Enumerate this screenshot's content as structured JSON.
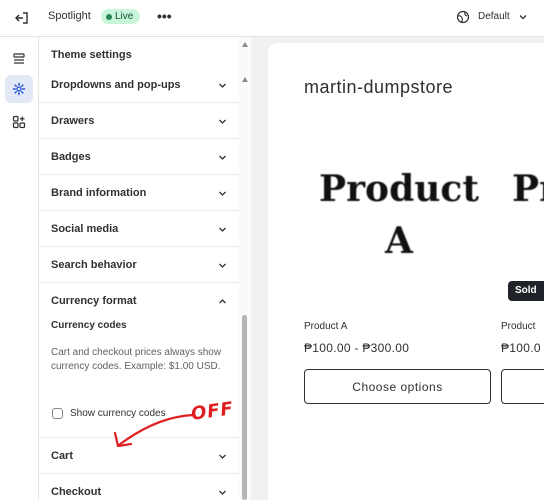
{
  "topbar": {
    "title": "Spotlight",
    "status_badge": "Live",
    "more_label": "•••",
    "theme_selector": "Default"
  },
  "panel": {
    "header": "Theme settings",
    "sections_top": [
      {
        "label": "Dropdowns and pop-ups"
      },
      {
        "label": "Drawers"
      },
      {
        "label": "Badges"
      },
      {
        "label": "Brand information"
      },
      {
        "label": "Social media"
      },
      {
        "label": "Search behavior"
      }
    ],
    "currency": {
      "label": "Currency format",
      "sub_label": "Currency codes",
      "help_text": "Cart and checkout prices always show currency codes. Example: $1.00 USD.",
      "checkbox_label": "Show currency codes",
      "checked": false
    },
    "sections_bottom": [
      {
        "label": "Cart"
      },
      {
        "label": "Checkout"
      }
    ]
  },
  "annotation": {
    "text": "OFF",
    "color": "#e02020"
  },
  "preview": {
    "store_name": "martin-dumpstore",
    "product_image_text": "Product A",
    "product_image_text_2": "Pr",
    "sold_badge": "Sold",
    "products": [
      {
        "name": "Product A",
        "price": "₱100.00 - ₱300.00",
        "button": "Choose options"
      },
      {
        "name": "Product",
        "price": "₱100.0"
      }
    ]
  },
  "colors": {
    "accent_active": "#e3e8f6",
    "live_bg": "#c9f6da",
    "live_text": "#0c5132"
  }
}
